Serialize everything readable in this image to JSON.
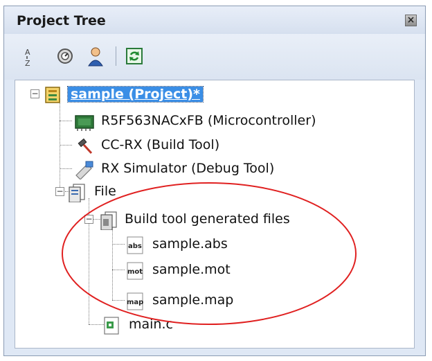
{
  "panel": {
    "title": "Project Tree",
    "close_label": "×"
  },
  "toolbar": {
    "buttons": [
      {
        "name": "sort-icon"
      },
      {
        "name": "property-icon"
      },
      {
        "name": "user-icon"
      },
      {
        "name": "refresh-icon"
      }
    ]
  },
  "tree": {
    "project": {
      "label": "sample (Project)*",
      "selected": true
    },
    "microcontroller": {
      "label": "R5F563NACxFB (Microcontroller)"
    },
    "build_tool": {
      "label": "CC-RX (Build Tool)"
    },
    "debug_tool": {
      "label": "RX Simulator (Debug Tool)"
    },
    "file": {
      "label": "File"
    },
    "generated": {
      "label": "Build tool generated files"
    },
    "abs": {
      "label": "sample.abs",
      "icon_text": "abs"
    },
    "mot": {
      "label": "sample.mot",
      "icon_text": "mot"
    },
    "map": {
      "label": "sample.map",
      "icon_text": "map"
    },
    "main": {
      "label": "main.c"
    }
  },
  "colors": {
    "selection": "#3a8ee6",
    "highlight_ellipse": "#e02020"
  }
}
